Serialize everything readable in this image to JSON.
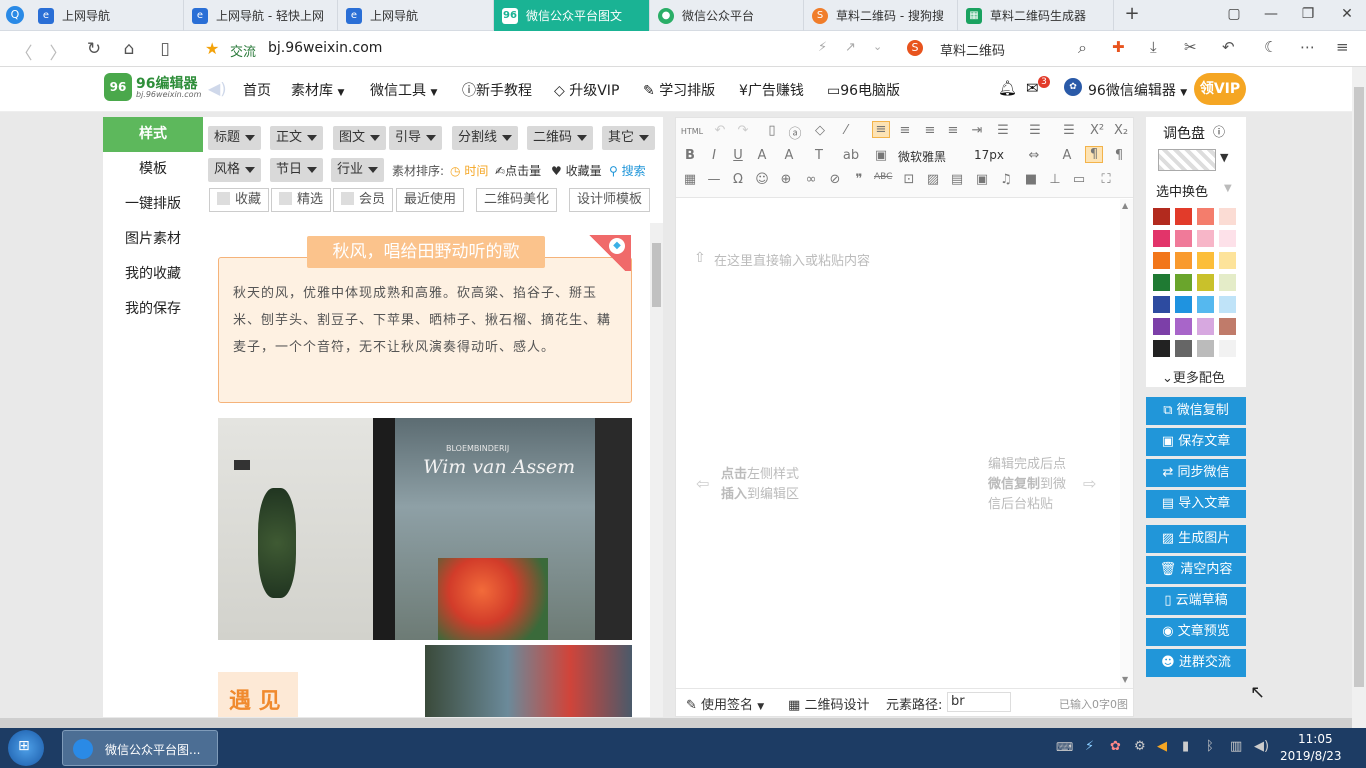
{
  "browser": {
    "tabs": [
      {
        "label": "上网导航",
        "icon": "e-icon",
        "color": "#2a6fd6"
      },
      {
        "label": "上网导航 - 轻快上网",
        "icon": "e-icon",
        "color": "#2a6fd6"
      },
      {
        "label": "上网导航",
        "icon": "e-icon",
        "color": "#2a6fd6"
      },
      {
        "label": "微信公众平台图文",
        "icon": "96-icon",
        "color": "#1ab394",
        "active": true
      },
      {
        "label": "微信公众平台",
        "icon": "wechat-icon",
        "color": "#2aae67"
      },
      {
        "label": "草料二维码 - 搜狗搜",
        "icon": "sogou-icon",
        "color": "#f07d2a"
      },
      {
        "label": "草料二维码生成器",
        "icon": "qr-icon",
        "color": "#1aa260"
      }
    ],
    "address": {
      "star_label": "交流",
      "url": "bj.96weixin.com",
      "search_text": "草料二维码"
    }
  },
  "site": {
    "logo_main": "96编辑器",
    "logo_sub": "bj.96weixin.com",
    "nav": [
      {
        "label": "首页"
      },
      {
        "label": "素材库"
      },
      {
        "label": "微信工具"
      },
      {
        "label": "新手教程",
        "icon": "?"
      },
      {
        "label": "升级VIP",
        "icon": "◇"
      },
      {
        "label": "学习排版",
        "icon": "✎"
      },
      {
        "label": "广告赚钱",
        "icon": "¥"
      },
      {
        "label": "96电脑版",
        "icon": "▭"
      }
    ],
    "mail_count": "3",
    "user_name": "96微信编辑器",
    "vip_badge": "领VIP"
  },
  "left_menu": [
    "样式",
    "模板",
    "一键排版",
    "图片素材",
    "我的收藏",
    "我的保存"
  ],
  "material": {
    "dropdowns_row1": [
      "标题",
      "正文",
      "图文",
      "引导",
      "分割线",
      "二维码",
      "其它"
    ],
    "dropdowns_row2": [
      "风格",
      "节日",
      "行业"
    ],
    "sort_label": "素材排序:",
    "sort_options": [
      "时间",
      "点击量",
      "收藏量"
    ],
    "search_label": "搜索",
    "filters": [
      "收藏",
      "精选",
      "会员"
    ],
    "buttons": [
      "最近使用",
      "二维码美化",
      "设计师模板"
    ],
    "card_title": "秋风，唱给田野动听的歌",
    "card_text": "秋天的风，优雅中体现成熟和高雅。砍高粱、掐谷子、掰玉米、刨芋头、割豆子、下苹果、晒柿子、揪石榴、摘花生、耩麦子，一个个音符，无不让秋风演奏得动听、感人。",
    "photo_sign": "Wim van Assem",
    "photo_sign_small": "BLOEMBINDERIJ",
    "card2_title": "遇 见"
  },
  "editor": {
    "font_name": "微软雅黑",
    "font_size": "17px",
    "placeholder": "在这里直接输入或粘贴内容",
    "hint_left_bold1": "点击",
    "hint_left_1": "左侧样式",
    "hint_left_bold2": "插入",
    "hint_left_2": "到编辑区",
    "hint_right_1": "编辑完成后点",
    "hint_right_bold": "微信复制",
    "hint_right_2": "到微",
    "hint_right_3": "信后台粘贴",
    "footer_sign": "使用签名",
    "footer_qr": "二维码设计",
    "footer_path_label": "元素路径:",
    "footer_path_value": "br",
    "footer_count": "已输入0字0图"
  },
  "palette": {
    "title": "调色盘",
    "change_label": "选中换色",
    "more_label": "更多配色",
    "colors": [
      "#b22a1e",
      "#e23b2a",
      "#f47d6c",
      "#fbdcd4",
      "#e2346a",
      "#f07a99",
      "#f7b6c8",
      "#fde1e9",
      "#f2761a",
      "#f99a2e",
      "#fcbe3a",
      "#fde39a",
      "#1f7a33",
      "#6aa52c",
      "#c9c12b",
      "#e4ecc8",
      "#2d4ba0",
      "#1f93e0",
      "#55b8ef",
      "#bfe3f8",
      "#7c3fa8",
      "#a865c9",
      "#d7a8e0",
      "#c07b6a",
      "#222222",
      "#666666",
      "#bbbbbb",
      "#f2f2f2"
    ]
  },
  "actions": [
    "微信复制",
    "保存文章",
    "同步微信",
    "导入文章",
    "生成图片",
    "清空内容",
    "云端草稿",
    "文章预览",
    "进群交流"
  ],
  "taskbar": {
    "app_label": "微信公众平台图...",
    "time": "11:05",
    "date": "2019/8/23"
  }
}
